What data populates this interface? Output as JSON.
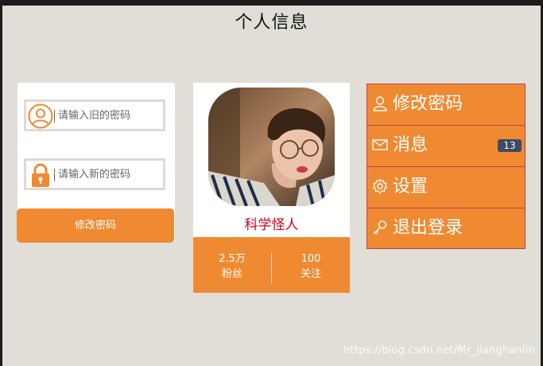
{
  "page": {
    "title": "个人信息"
  },
  "password_card": {
    "old_placeholder": "请输入旧的密码",
    "new_placeholder": "请输入新的密码",
    "button_label": "修改密码"
  },
  "profile": {
    "name": "科学怪人",
    "stats": [
      {
        "value": "2.5万",
        "label": "粉丝"
      },
      {
        "value": "100",
        "label": "关注"
      }
    ]
  },
  "menu": {
    "items": [
      {
        "label": "修改密码",
        "icon": "user-icon"
      },
      {
        "label": "消息",
        "icon": "mail-icon",
        "badge": "13"
      },
      {
        "label": "设置",
        "icon": "gear-icon"
      },
      {
        "label": "退出登录",
        "icon": "key-icon"
      }
    ]
  },
  "colors": {
    "accent": "#ef8a32",
    "background": "#e1ded7",
    "name": "#d0021b",
    "badge": "#3e4a63"
  },
  "watermark": "https://blog.csdn.net/Mr_jianghanlin"
}
